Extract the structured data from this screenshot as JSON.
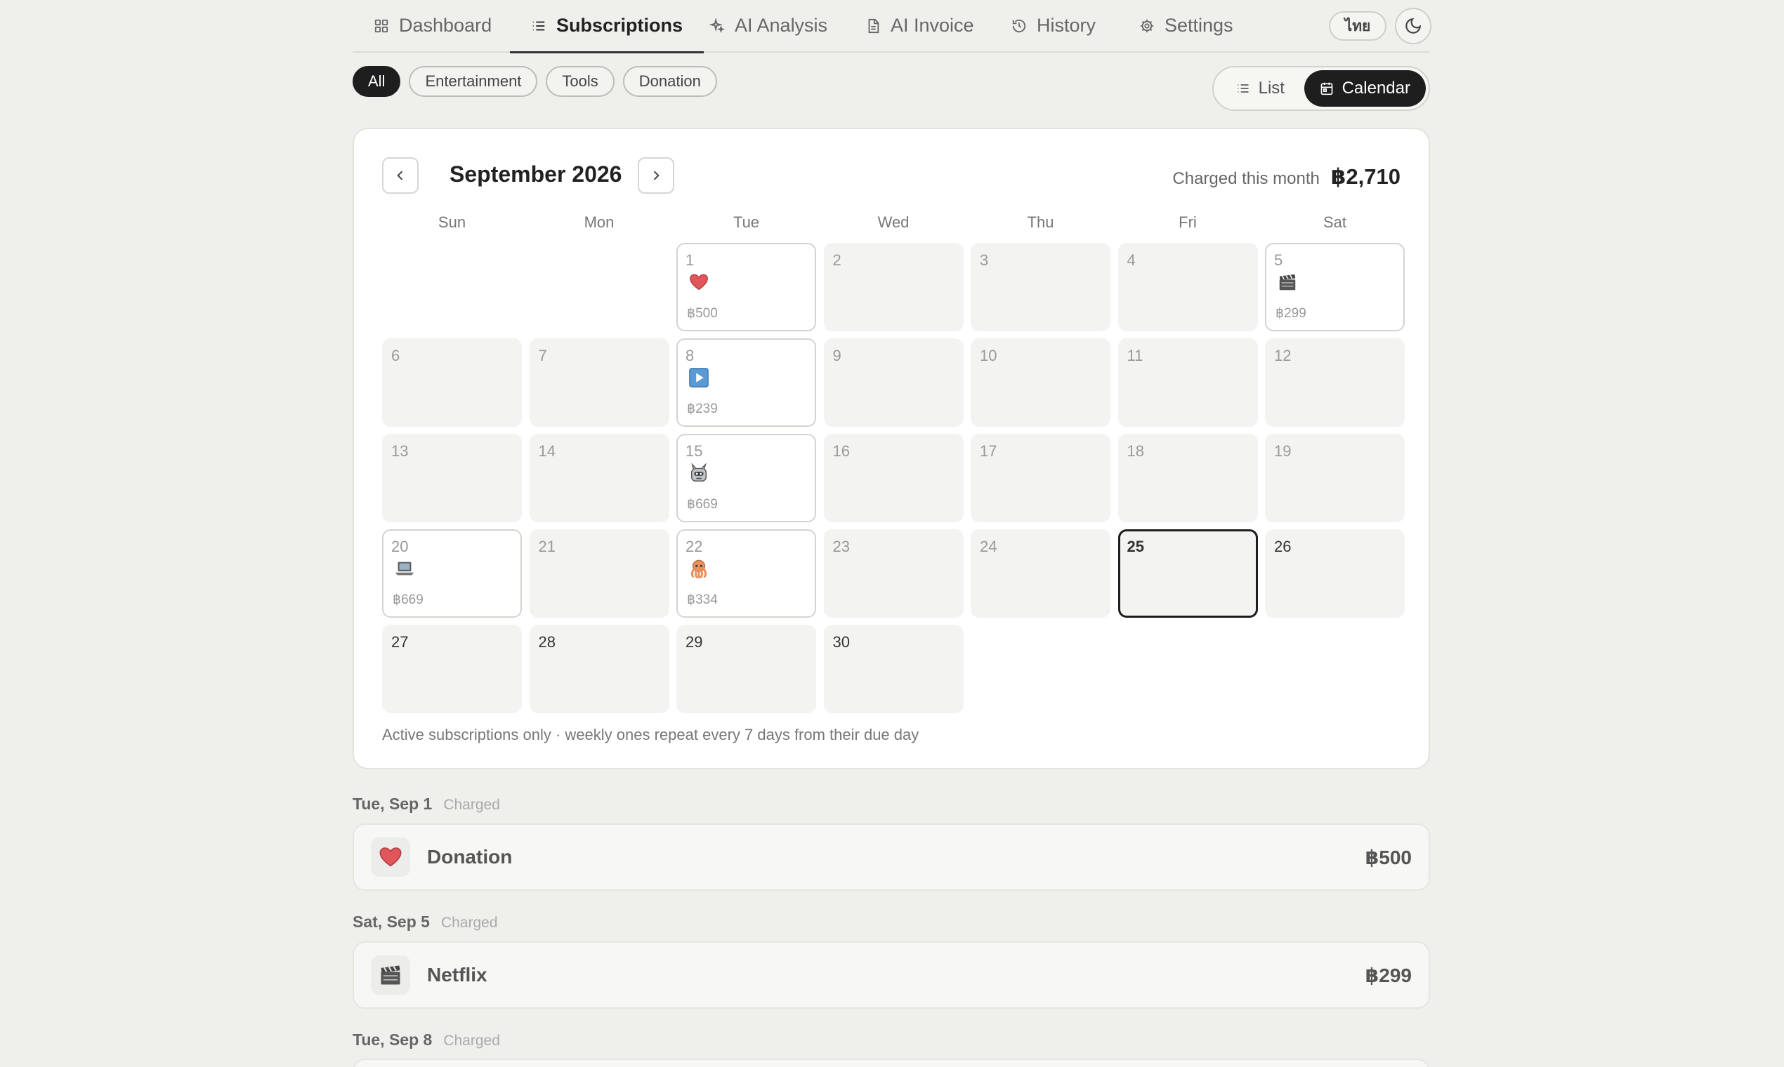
{
  "nav": {
    "tabs": [
      {
        "label": "Dashboard",
        "icon": "grid-icon"
      },
      {
        "label": "Subscriptions",
        "icon": "list-icon",
        "active": true
      },
      {
        "label": "AI Analysis",
        "icon": "sparkle-icon"
      },
      {
        "label": "AI Invoice",
        "icon": "document-icon"
      },
      {
        "label": "History",
        "icon": "history-icon"
      },
      {
        "label": "Settings",
        "icon": "gear-icon"
      }
    ],
    "language": "ไทย",
    "theme_icon": "moon-icon"
  },
  "filters": {
    "chips": [
      "All",
      "Entertainment",
      "Tools",
      "Donation"
    ],
    "selected": "All"
  },
  "view_toggle": {
    "list_label": "List",
    "calendar_label": "Calendar",
    "selected": "Calendar"
  },
  "calendar": {
    "month_title": "September 2026",
    "charged_label": "Charged this month",
    "charged_value": "฿2,710",
    "weekdays": [
      "Sun",
      "Mon",
      "Tue",
      "Wed",
      "Thu",
      "Fri",
      "Sat"
    ],
    "leading_blanks": 2,
    "days_in_month": 30,
    "today": 25,
    "events": {
      "1": {
        "icon": "heart-icon",
        "amount": "฿500"
      },
      "5": {
        "icon": "clapperboard-icon",
        "amount": "฿299"
      },
      "8": {
        "icon": "play-icon",
        "amount": "฿239"
      },
      "15": {
        "icon": "robot-icon",
        "amount": "฿669"
      },
      "20": {
        "icon": "laptop-icon",
        "amount": "฿669"
      },
      "22": {
        "icon": "octopus-icon",
        "amount": "฿334"
      }
    },
    "note": "Active subscriptions only · weekly ones repeat every 7 days from their due day"
  },
  "upcoming": [
    {
      "date": "Tue, Sep 1",
      "status": "Charged",
      "name": "Donation",
      "icon": "heart-icon",
      "amount": "฿500"
    },
    {
      "date": "Sat, Sep 5",
      "status": "Charged",
      "name": "Netflix",
      "icon": "clapperboard-icon",
      "amount": "฿299"
    },
    {
      "date": "Tue, Sep 8",
      "status": "Charged"
    }
  ]
}
